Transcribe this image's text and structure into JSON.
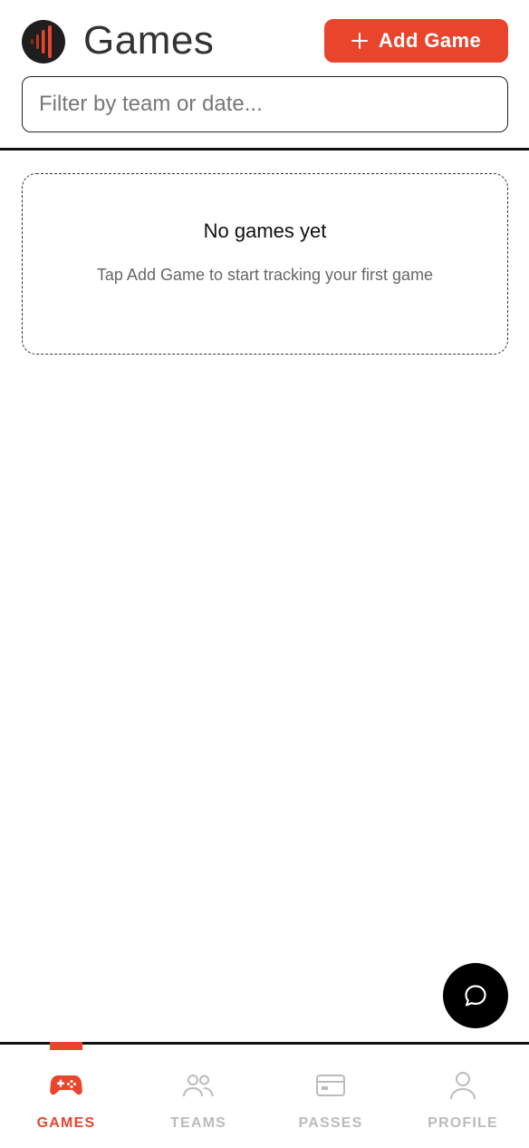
{
  "header": {
    "title": "Games",
    "add_button_label": "Add Game",
    "filter_placeholder": "Filter by team or date..."
  },
  "empty_state": {
    "title": "No games yet",
    "description": "Tap Add Game to start tracking your first game"
  },
  "nav": {
    "items": [
      {
        "label": "GAMES",
        "icon": "gamepad-icon",
        "active": true
      },
      {
        "label": "TEAMS",
        "icon": "users-icon",
        "active": false
      },
      {
        "label": "PASSES",
        "icon": "card-icon",
        "active": false
      },
      {
        "label": "PROFILE",
        "icon": "user-icon",
        "active": false
      }
    ]
  },
  "colors": {
    "accent": "#e8452c",
    "inactive": "#bbbbbb",
    "text": "#333333"
  }
}
